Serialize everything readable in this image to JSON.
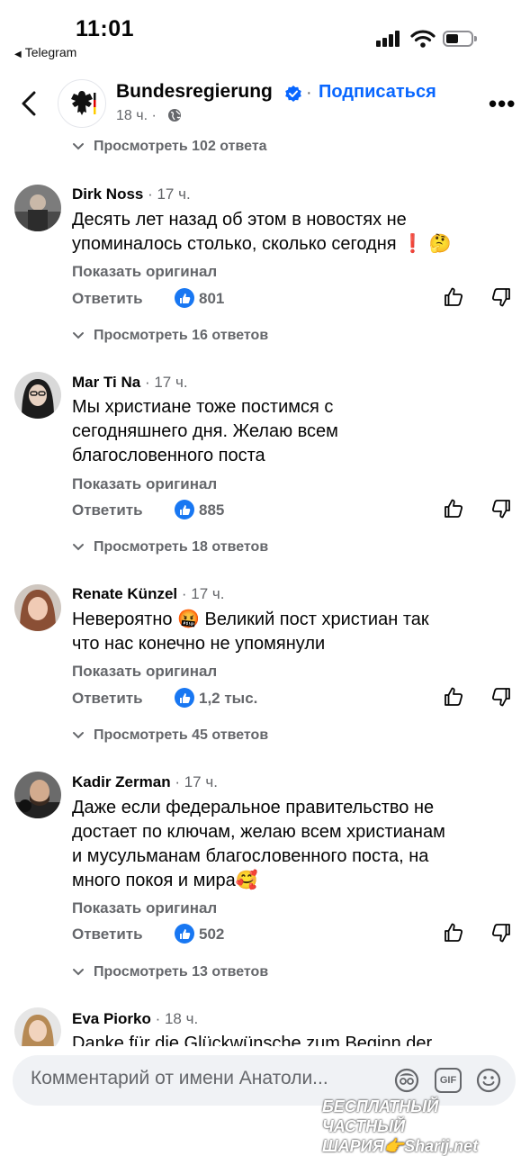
{
  "status_bar": {
    "time": "11:01",
    "back_app": "Telegram"
  },
  "header": {
    "page_name": "Bundesregierung",
    "separator": "·",
    "subscribe_label": "Подписаться",
    "time_meta": "18 ч. ·"
  },
  "top_replies": {
    "label": "Просмотреть 102 ответа"
  },
  "comments": [
    {
      "author": "Dirk Noss",
      "meta": " · 17 ч.",
      "text_lines": [
        "Десять лет назад об этом в новостях не",
        "упоминалось столько, сколько сегодня ❗ 🤔"
      ],
      "show_original": "Показать оригинал",
      "reply_label": "Ответить",
      "likes": "801",
      "replies_label": "Просмотреть 16 ответов"
    },
    {
      "author": "Mar Ti Na",
      "meta": " · 17 ч.",
      "text_lines": [
        "Мы христиане тоже постимся с",
        "сегодняшнего дня. Желаю всем",
        "благословенного поста"
      ],
      "show_original": "Показать оригинал",
      "reply_label": "Ответить",
      "likes": "885",
      "replies_label": "Просмотреть 18 ответов"
    },
    {
      "author": "Renate Künzel",
      "meta": " · 17 ч.",
      "text_lines": [
        "Невероятно 🤬 Великий пост христиан так",
        "что нас конечно не упомянули"
      ],
      "show_original": "Показать оригинал",
      "reply_label": "Ответить",
      "likes": "1,2 тыс.",
      "replies_label": "Просмотреть 45 ответов"
    },
    {
      "author": "Kadir Zerman",
      "meta": " · 17 ч.",
      "text_lines": [
        "Даже если федеральное правительство не",
        "достает по ключам, желаю всем христианам",
        "и мусульманам благословенного поста, на",
        "много покоя и мира🥰"
      ],
      "show_original": "Показать оригинал",
      "reply_label": "Ответить",
      "likes": "502",
      "replies_label": "Просмотреть 13 ответов"
    },
    {
      "author": "Eva Piorko",
      "meta": " · 18 ч.",
      "text_lines": [
        "Danke für die Glückwünsche zum Beginn der"
      ]
    }
  ],
  "composer": {
    "placeholder": "Комментарий от имени Анатоли...",
    "gif_label": "GIF"
  },
  "watermark": {
    "line1": "БЕСПЛАТНЫЙ ЧАСТНЫЙ",
    "line2": "ШАРИЯ👉Sharij.net"
  },
  "colors": {
    "accent": "#0866ff",
    "like_badge": "#1877f2",
    "secondary_text": "#65676b",
    "composer_bg": "#f0f2f5"
  },
  "icons": [
    "back-chevron-icon",
    "verified-icon",
    "globe-icon",
    "more-icon",
    "chevron-down-icon",
    "like-badge-icon",
    "thumbs-up-icon",
    "thumbs-down-icon",
    "avatar-sticker-icon",
    "gif-icon",
    "emoji-icon"
  ]
}
